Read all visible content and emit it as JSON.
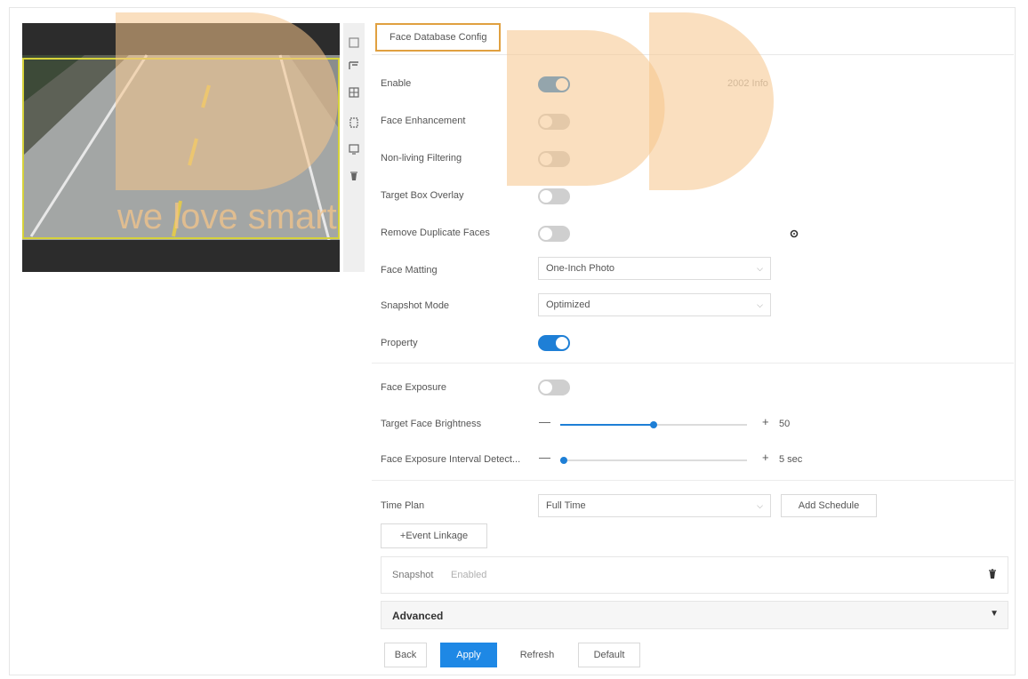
{
  "tab": {
    "label": "Face Database Config"
  },
  "toolbar_icons": [
    "pointer-icon",
    "rule-icon",
    "grid-icon",
    "region-icon",
    "target-icon",
    "clear-icon"
  ],
  "rows": {
    "enable": {
      "label": "Enable",
      "on": true,
      "side_text": "2002 Info"
    },
    "face_enhancement": {
      "label": "Face Enhancement",
      "on": false
    },
    "non_living": {
      "label": "Non-living Filtering",
      "on": false
    },
    "target_box": {
      "label": "Target Box Overlay",
      "on": false
    },
    "remove_dup": {
      "label": "Remove Duplicate Faces",
      "on": false
    },
    "face_matting": {
      "label": "Face Matting",
      "value": "One-Inch Photo"
    },
    "snapshot_mode": {
      "label": "Snapshot Mode",
      "value": "Optimized"
    },
    "property": {
      "label": "Property",
      "on": true
    },
    "face_exposure": {
      "label": "Face Exposure",
      "on": false
    },
    "brightness": {
      "label": "Target Face Brightness",
      "value": "50",
      "fraction": 0.5,
      "minus": "—",
      "plus": "+"
    },
    "interval": {
      "label": "Face Exposure Interval Detect...",
      "value": "5 sec",
      "fraction": 0.02,
      "minus": "—",
      "plus": "+"
    }
  },
  "time_plan": {
    "label": "Time Plan",
    "value": "Full Time",
    "add_schedule": "Add Schedule"
  },
  "event_linkage": {
    "label": "+Event Linkage"
  },
  "snapshot": {
    "label": "Snapshot",
    "status": "Enabled"
  },
  "advanced": {
    "label": "Advanced"
  },
  "actions": {
    "back": "Back",
    "apply": "Apply",
    "refresh": "Refresh",
    "default": "Default"
  },
  "watermark": {
    "text": "we love smart"
  },
  "colors": {
    "accent": "#1e7fd6",
    "tab_border": "#e0a040",
    "watermark": "#f5c58a"
  }
}
